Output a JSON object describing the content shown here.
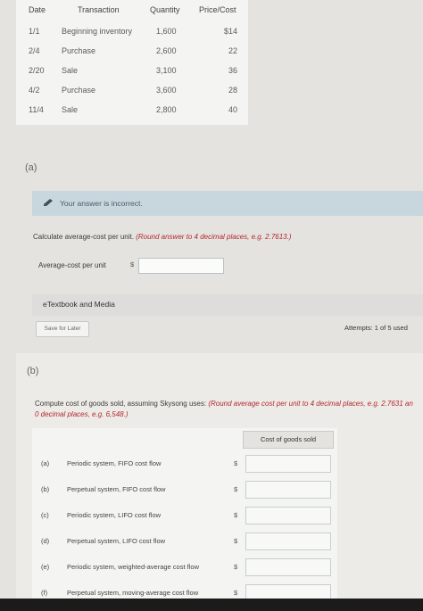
{
  "table": {
    "headers": [
      "Date",
      "Transaction",
      "Quantity",
      "Price/Cost"
    ],
    "rows": [
      {
        "date": "1/1",
        "transaction": "Beginning inventory",
        "quantity": "1,600",
        "price": "$14"
      },
      {
        "date": "2/4",
        "transaction": "Purchase",
        "quantity": "2,600",
        "price": "22"
      },
      {
        "date": "2/20",
        "transaction": "Sale",
        "quantity": "3,100",
        "price": "36"
      },
      {
        "date": "4/2",
        "transaction": "Purchase",
        "quantity": "3,600",
        "price": "28"
      },
      {
        "date": "11/4",
        "transaction": "Sale",
        "quantity": "2,800",
        "price": "40"
      }
    ]
  },
  "part_a": {
    "label": "(a)",
    "notice": "Your answer is incorrect.",
    "question": "Calculate average-cost per unit.",
    "instruction": "(Round answer to 4 decimal places, e.g. 2.7613.)",
    "field_label": "Average-cost per unit",
    "currency": "$",
    "value": "",
    "etextbook": "eTextbook and Media",
    "save_label": "Save for Later",
    "attempts": "Attempts: 1 of 5 used"
  },
  "part_b": {
    "label": "(b)",
    "question": "Compute cost of goods sold, assuming Skysong uses:",
    "instruction_line1": "(Round average cost per unit to 4 decimal places, e.g. 2.7631 an",
    "instruction_line2": "0 decimal places, e.g. 6,548.)",
    "column_header": "Cost of goods sold",
    "currency": "$",
    "rows": [
      {
        "letter": "(a)",
        "label": "Periodic system, FIFO cost flow"
      },
      {
        "letter": "(b)",
        "label": "Perpetual system, FIFO cost flow"
      },
      {
        "letter": "(c)",
        "label": "Periodic system, LIFO cost flow"
      },
      {
        "letter": "(d)",
        "label": "Perpetual system, LIFO cost flow"
      },
      {
        "letter": "(e)",
        "label": "Periodic system, weighted-average cost flow"
      },
      {
        "letter": "(f)",
        "label": "Perpetual system, moving-average cost flow"
      }
    ]
  },
  "colors": {
    "notice_bg": "#c8d7de",
    "instruction_red": "#b4282e",
    "input_border": "#b9c2c6"
  }
}
